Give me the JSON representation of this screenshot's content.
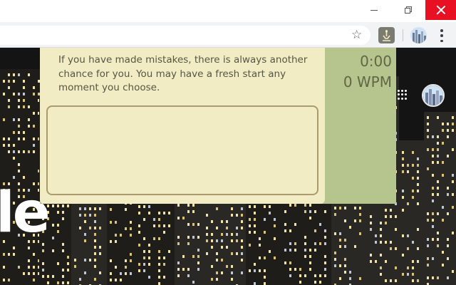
{
  "window": {
    "controls": [
      "minimize",
      "restore",
      "close"
    ],
    "close_color": "#e81123"
  },
  "toolbar": {
    "bookmark_icon": "star-icon",
    "extension_icon": "typing-extension-icon",
    "menu_icon": "kebab-menu-icon"
  },
  "page": {
    "logo_fragment": "le",
    "apps_icon": "apps-grid-icon"
  },
  "popup": {
    "quote": "If you have made mistakes, there is always another chance for you. You may have a fresh start any moment you choose.",
    "input_value": "",
    "timer": "0:00",
    "wpm": "0 WPM",
    "colors": {
      "panel": "#f2ecc4",
      "sidebar": "#b5c58d",
      "input_border": "#aa9a6e"
    }
  }
}
